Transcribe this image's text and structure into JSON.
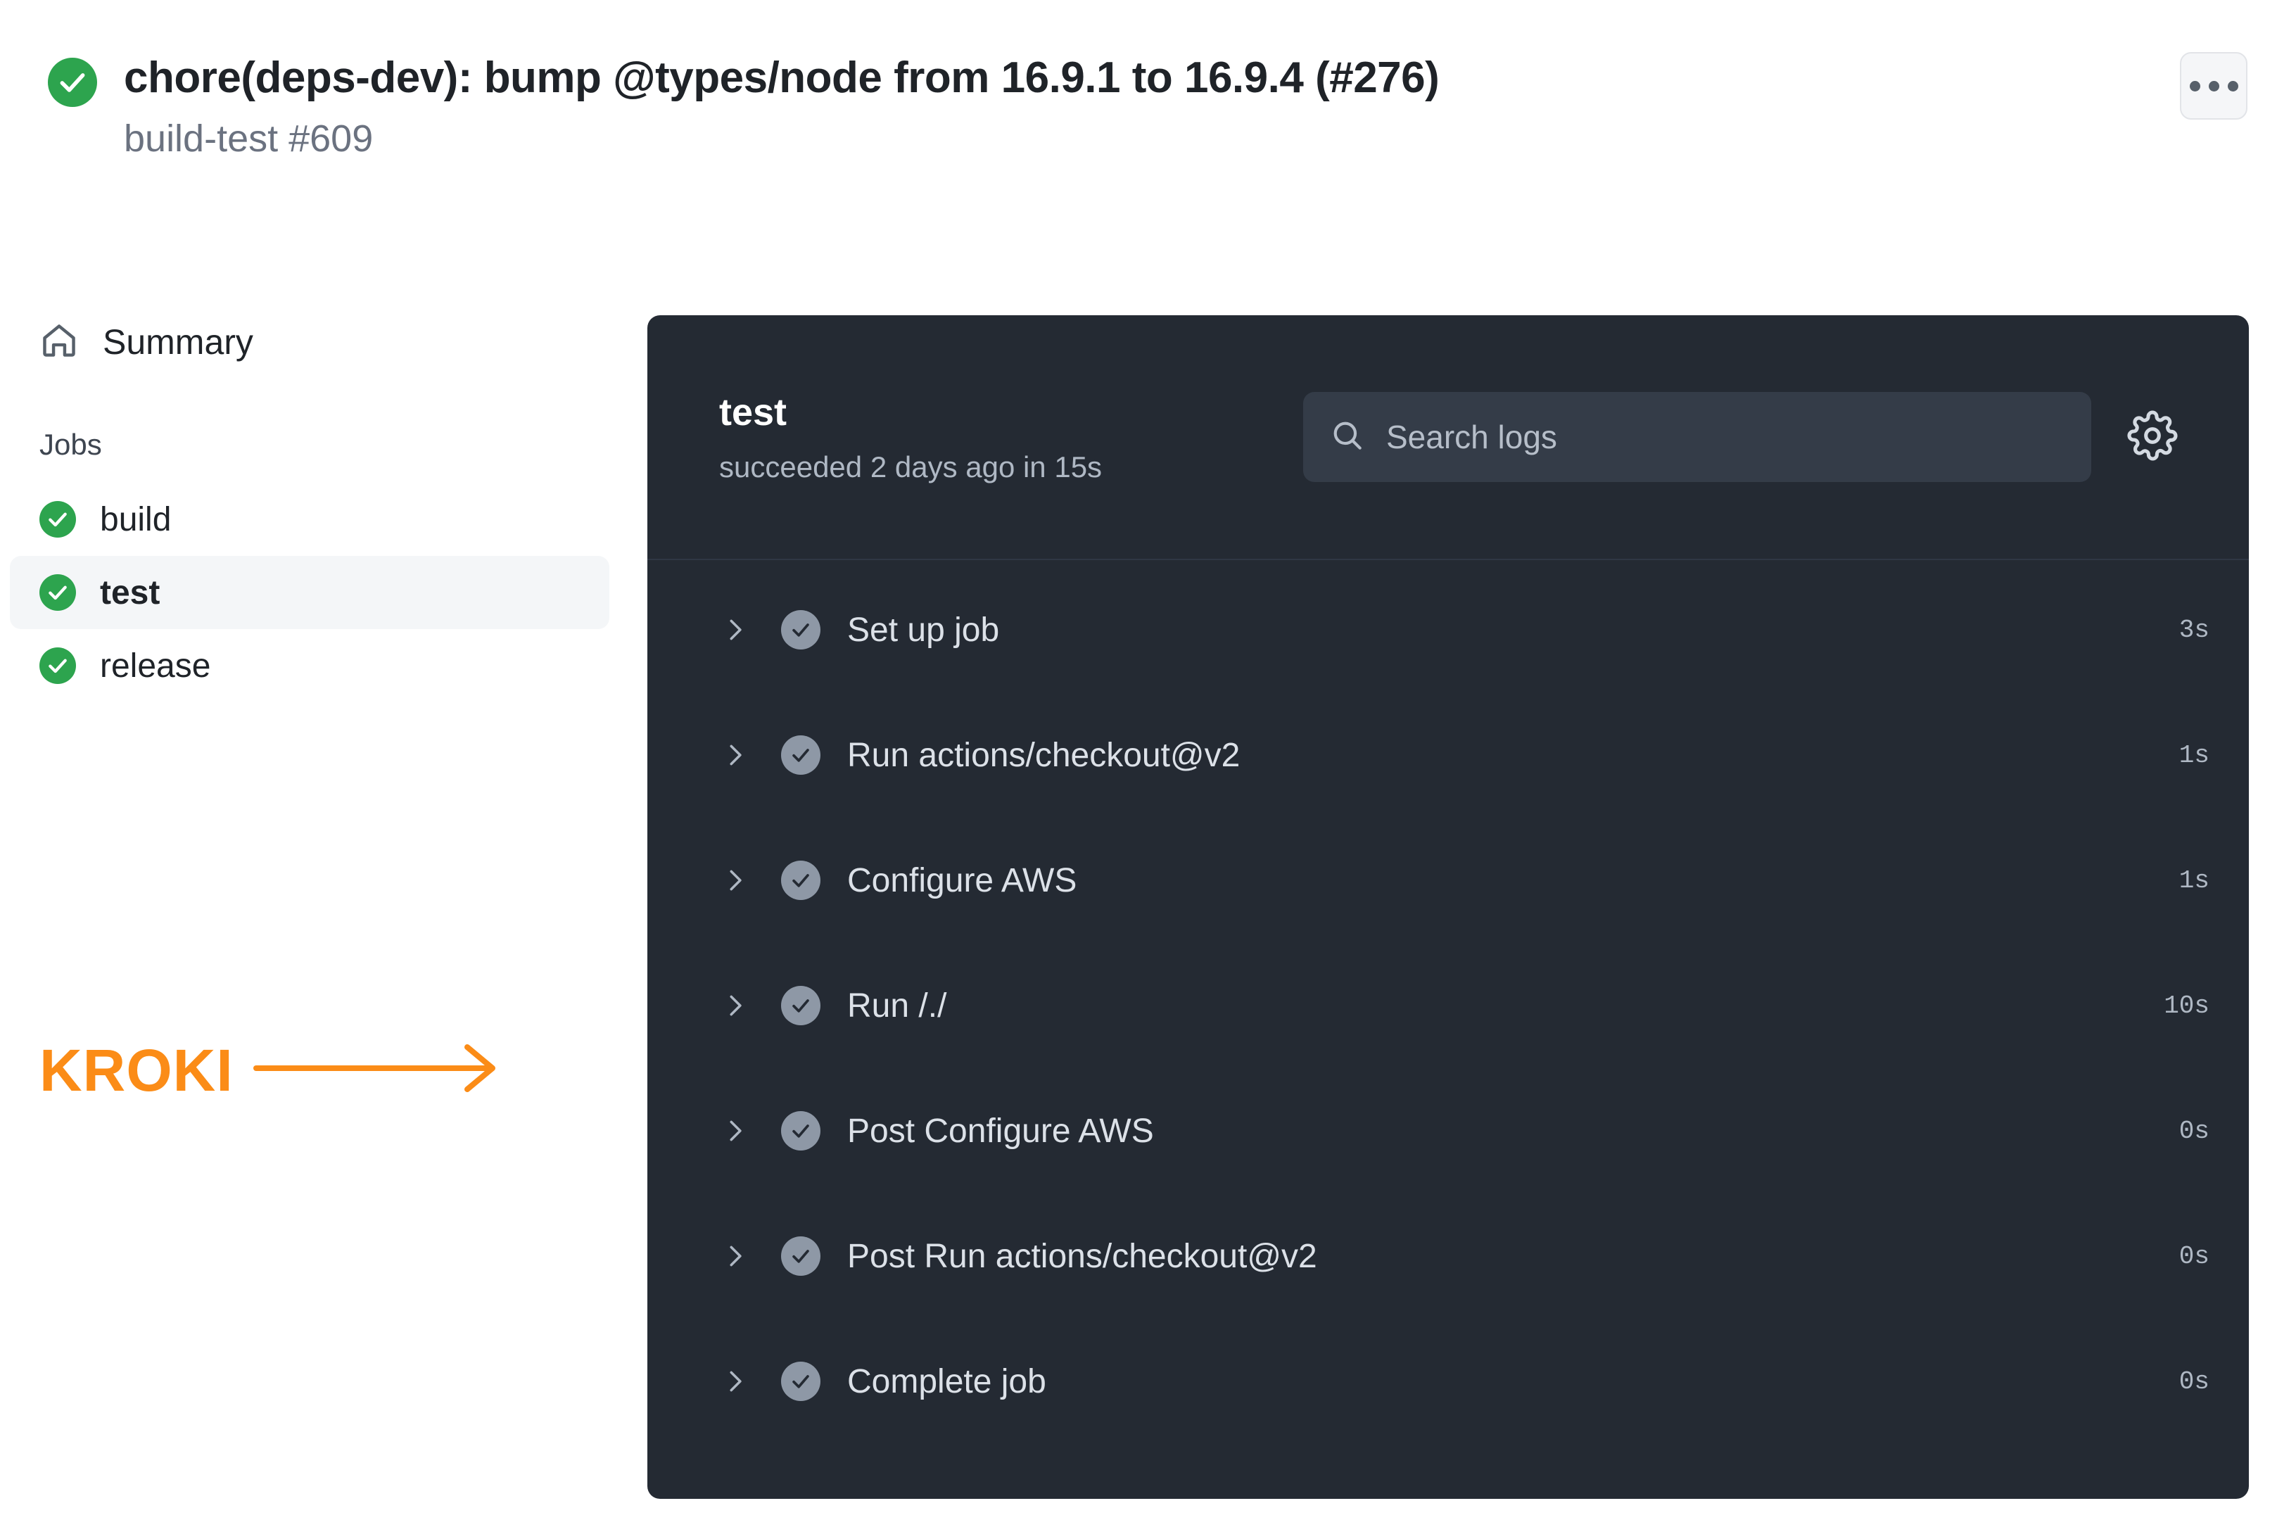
{
  "header": {
    "status_icon": "check-circle-icon",
    "status_color": "#2DA44E",
    "title": "chore(deps-dev): bump @types/node from 16.9.1 to 16.9.4 (#276)",
    "subtitle": "build-test #609",
    "more_button_label": "…",
    "more_icon": "kebab-horizontal-icon"
  },
  "sidebar": {
    "summary": {
      "icon": "home-icon",
      "label": "Summary"
    },
    "jobs_heading": "Jobs",
    "jobs": [
      {
        "label": "build",
        "status_icon": "check-circle-icon",
        "selected": false
      },
      {
        "label": "test",
        "status_icon": "check-circle-icon",
        "selected": true
      },
      {
        "label": "release",
        "status_icon": "check-circle-icon",
        "selected": false
      }
    ]
  },
  "annotation": {
    "text": "KROKI",
    "color": "#FB8C17",
    "arrow_icon": "arrow-right-icon"
  },
  "log_panel": {
    "job_title": "test",
    "job_status": "succeeded 2 days ago in 15s",
    "search": {
      "icon": "search-icon",
      "placeholder": "Search logs",
      "value": ""
    },
    "settings_icon": "gear-icon",
    "steps": [
      {
        "toggle_icon": "chevron-right-icon",
        "status_icon": "check-circle-icon",
        "label": "Set up job",
        "duration": "3s"
      },
      {
        "toggle_icon": "chevron-right-icon",
        "status_icon": "check-circle-icon",
        "label": "Run actions/checkout@v2",
        "duration": "1s"
      },
      {
        "toggle_icon": "chevron-right-icon",
        "status_icon": "check-circle-icon",
        "label": "Configure AWS",
        "duration": "1s"
      },
      {
        "toggle_icon": "chevron-right-icon",
        "status_icon": "check-circle-icon",
        "label": "Run /./",
        "duration": "10s"
      },
      {
        "toggle_icon": "chevron-right-icon",
        "status_icon": "check-circle-icon",
        "label": "Post Configure AWS",
        "duration": "0s"
      },
      {
        "toggle_icon": "chevron-right-icon",
        "status_icon": "check-circle-icon",
        "label": "Post Run actions/checkout@v2",
        "duration": "0s"
      },
      {
        "toggle_icon": "chevron-right-icon",
        "status_icon": "check-circle-icon",
        "label": "Complete job",
        "duration": "0s"
      }
    ]
  },
  "colors": {
    "success_green": "#2DA44E",
    "panel_bg": "#242A33",
    "search_bg": "#343C48",
    "accent_orange": "#FB8C17",
    "selected_row_bg": "#F4F6F8"
  }
}
